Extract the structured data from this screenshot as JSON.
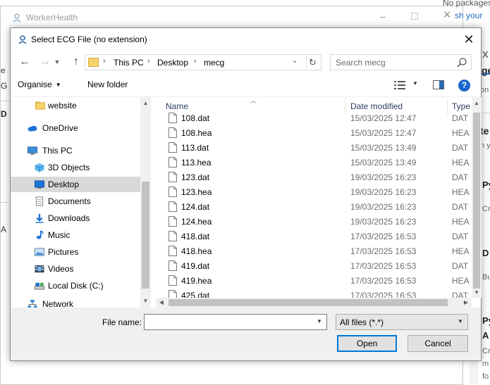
{
  "background_window": {
    "title": "WorkerHealth",
    "side_fragments": [
      "e",
      "G",
      "D",
      "A"
    ]
  },
  "right_panel": {
    "top_text_1": "No packages",
    "top_text_2": "sh your",
    "frag_x": "X",
    "frag_ge": "ge",
    "frag_on": "on",
    "frag_te": "te",
    "frag_ny": "n y",
    "frag_py": "Py",
    "frag_cr": "Cr",
    "frag_d": "D",
    "frag_bu": "Bu",
    "frag_py2": "Py",
    "frag_a": "A",
    "frag_cr2": "Cr",
    "frag_m": "m",
    "frag_fo": "fo"
  },
  "dialog": {
    "title": "Select ECG File (no extension)",
    "address": [
      "This PC",
      "Desktop",
      "mecg"
    ],
    "search_placeholder": "Search mecg",
    "toolbar": {
      "organise_label": "Organise",
      "new_folder_label": "New folder"
    },
    "nav_items": [
      {
        "label": "website",
        "icon": "folder-icon",
        "selected": false
      },
      {
        "label": "OneDrive",
        "icon": "cloud-icon",
        "selected": false
      },
      {
        "label": "This PC",
        "icon": "computer-icon",
        "selected": false
      },
      {
        "label": "3D Objects",
        "icon": "cube-icon",
        "selected": false
      },
      {
        "label": "Desktop",
        "icon": "desktop-icon",
        "selected": true
      },
      {
        "label": "Documents",
        "icon": "document-icon",
        "selected": false
      },
      {
        "label": "Downloads",
        "icon": "download-icon",
        "selected": false
      },
      {
        "label": "Music",
        "icon": "music-icon",
        "selected": false
      },
      {
        "label": "Pictures",
        "icon": "picture-icon",
        "selected": false
      },
      {
        "label": "Videos",
        "icon": "video-icon",
        "selected": false
      },
      {
        "label": "Local Disk (C:)",
        "icon": "drive-icon",
        "selected": false
      },
      {
        "label": "Network",
        "icon": "network-icon",
        "selected": false
      }
    ],
    "columns": {
      "name": "Name",
      "date": "Date modified",
      "type": "Type"
    },
    "files": [
      {
        "name": "108.dat",
        "date": "15/03/2025 12:47",
        "type": "DAT"
      },
      {
        "name": "108.hea",
        "date": "15/03/2025 12:47",
        "type": "HEA"
      },
      {
        "name": "113.dat",
        "date": "15/03/2025 13:49",
        "type": "DAT"
      },
      {
        "name": "113.hea",
        "date": "15/03/2025 13:49",
        "type": "HEA"
      },
      {
        "name": "123.dat",
        "date": "19/03/2025 16:23",
        "type": "DAT"
      },
      {
        "name": "123.hea",
        "date": "19/03/2025 16:23",
        "type": "HEA"
      },
      {
        "name": "124.dat",
        "date": "19/03/2025 16:23",
        "type": "DAT"
      },
      {
        "name": "124.hea",
        "date": "19/03/2025 16:23",
        "type": "HEA"
      },
      {
        "name": "418.dat",
        "date": "17/03/2025 16:53",
        "type": "DAT"
      },
      {
        "name": "418.hea",
        "date": "17/03/2025 16:53",
        "type": "HEA"
      },
      {
        "name": "419.dat",
        "date": "17/03/2025 16:53",
        "type": "DAT"
      },
      {
        "name": "419.hea",
        "date": "17/03/2025 16:53",
        "type": "HEA"
      },
      {
        "name": "425.dat",
        "date": "17/03/2025 16:53",
        "type": "DAT"
      }
    ],
    "filename_label": "File name:",
    "filename_value": "",
    "filetype_value": "All files (*.*)",
    "open_label": "Open",
    "cancel_label": "Cancel"
  }
}
